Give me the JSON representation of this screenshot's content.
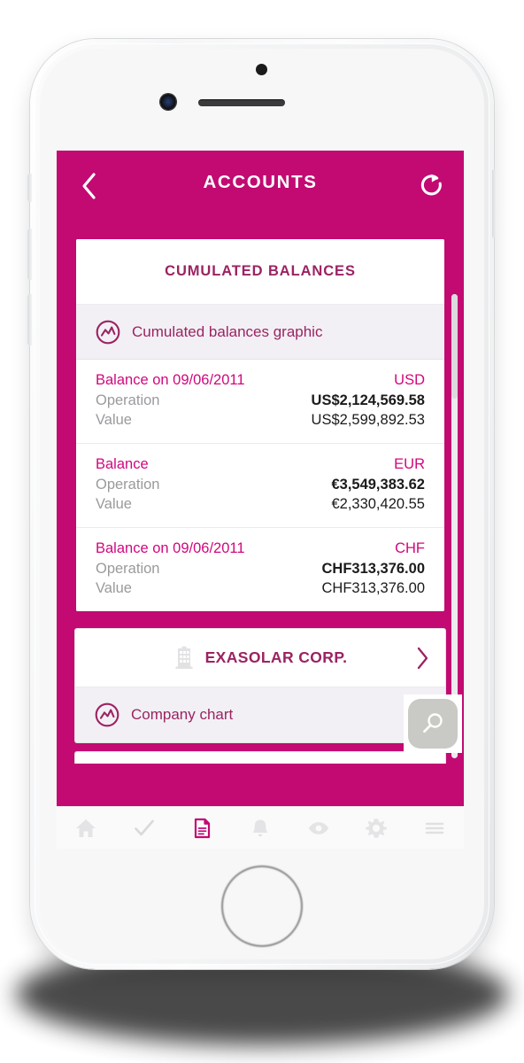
{
  "app": {
    "navbar": {
      "title": "ACCOUNTS",
      "back_icon": "chevron-left-icon",
      "refresh_icon": "refresh-icon",
      "background_color": "#C20A72"
    },
    "colors": {
      "brand_magenta": "#C20A72",
      "title_purple": "#9B2362",
      "label_pink": "#D1077E",
      "muted_gray": "#9A9A9E",
      "row_gray": "#F2F0F5"
    }
  },
  "balances_card": {
    "title": "CUMULATED BALANCES",
    "graphic_row": {
      "label": "Cumulated balances graphic",
      "icon": "chart-circle-icon"
    },
    "operation_label": "Operation",
    "value_label": "Value",
    "blocks": [
      {
        "label": "Balance on 09/06/2011",
        "currency": "USD",
        "operation": "US$2,124,569.58",
        "value": "US$2,599,892.53"
      },
      {
        "label": "Balance",
        "currency": "EUR",
        "operation": "€3,549,383.62",
        "value": "€2,330,420.55"
      },
      {
        "label": "Balance on 09/06/2011",
        "currency": "CHF",
        "operation": "CHF313,376.00",
        "value": "CHF313,376.00"
      }
    ]
  },
  "company_card": {
    "name": "EXASOLAR CORP.",
    "building_icon": "building-icon",
    "chevron_icon": "chevron-right-icon",
    "chart_row": {
      "label": "Company chart",
      "icon": "chart-circle-icon"
    }
  },
  "fab": {
    "icon": "search-icon"
  },
  "tabbar": {
    "items": [
      {
        "name": "home-icon",
        "active": false
      },
      {
        "name": "check-icon",
        "active": false
      },
      {
        "name": "document-icon",
        "active": true
      },
      {
        "name": "bell-icon",
        "active": false
      },
      {
        "name": "eye-icon",
        "active": false
      },
      {
        "name": "gear-icon",
        "active": false
      },
      {
        "name": "menu-icon",
        "active": false
      }
    ]
  }
}
